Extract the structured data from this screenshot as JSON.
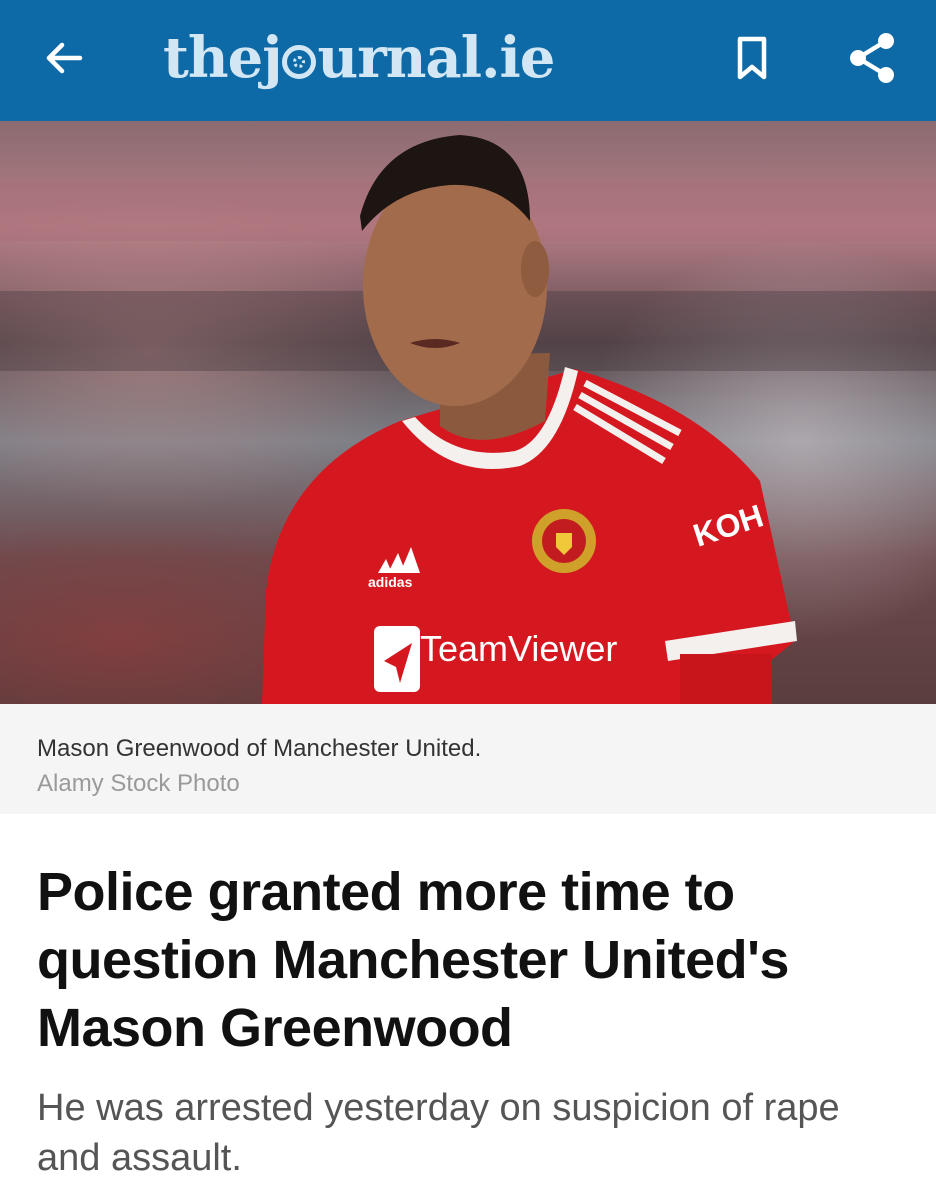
{
  "header": {
    "logo_prefix": "thej",
    "logo_suffix": "urnal.ie",
    "background_color": "#0d6aa6",
    "icons": {
      "back": "arrow-left-icon",
      "bookmark": "bookmark-icon",
      "share": "share-icon"
    }
  },
  "hero_image": {
    "jersey_sponsor": "TeamViewer",
    "sleeve_sponsor": "KOH",
    "kit_brand": "adidas"
  },
  "caption": {
    "text": "Mason Greenwood of Manchester United.",
    "credit": "Alamy Stock Photo"
  },
  "article": {
    "headline": "Police granted more time to question Manchester United's Mason Greenwood",
    "subheadline": "He was arrested yesterday on suspicion of rape and assault."
  }
}
